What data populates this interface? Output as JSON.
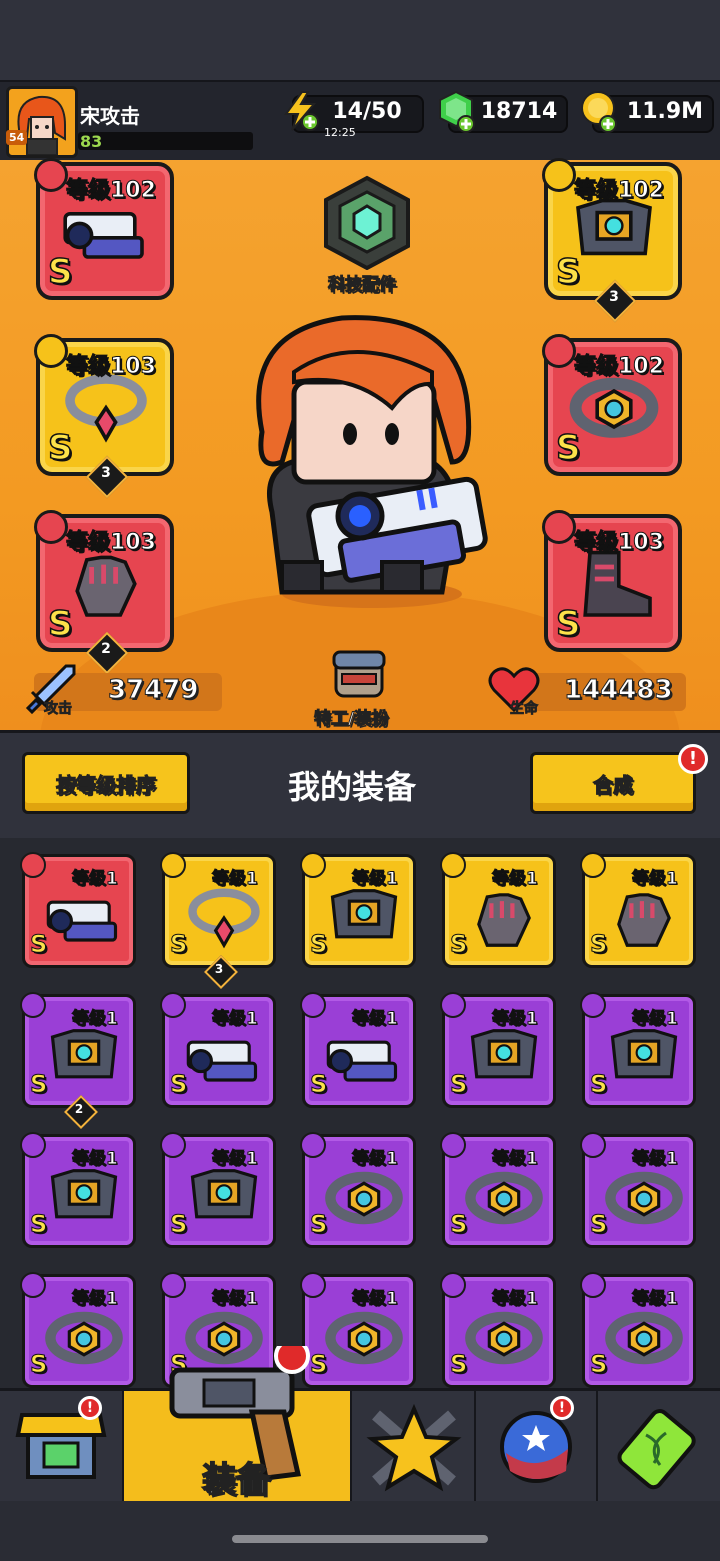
{
  "header": {
    "player_name": "宋攻击",
    "player_level": "83",
    "avatar_level": "54",
    "energy": "14/50",
    "energy_timer": "12:25",
    "gems": "18714",
    "coins": "11.9M"
  },
  "hero": {
    "tech_label": "科技配件",
    "attack_label": "攻击",
    "attack_value": "37479",
    "hp_label": "生命",
    "hp_value": "144483",
    "agent_label": "特工/装扮",
    "slots": [
      {
        "level": "等级102",
        "grade": "S",
        "color": "red",
        "icon": "weapon-icon"
      },
      {
        "level": "等级102",
        "grade": "S",
        "color": "yellow",
        "icon": "armor-icon",
        "count": "3"
      },
      {
        "level": "等级103",
        "grade": "S",
        "color": "yellow",
        "icon": "necklace-icon",
        "count": "3"
      },
      {
        "level": "等级102",
        "grade": "S",
        "color": "red",
        "icon": "belt-icon"
      },
      {
        "level": "等级103",
        "grade": "S",
        "color": "red",
        "icon": "glove-icon",
        "count": "2"
      },
      {
        "level": "等级103",
        "grade": "S",
        "color": "red",
        "icon": "boot-icon"
      }
    ]
  },
  "gear_bar": {
    "sort_button": "按等级排序",
    "title": "我的装备",
    "merge_button": "合成",
    "merge_alert": "!"
  },
  "inventory": [
    {
      "level": "等级1",
      "grade": "S",
      "color": "red",
      "icon": "weapon-icon"
    },
    {
      "level": "等级1",
      "grade": "S",
      "color": "yellow",
      "icon": "necklace-icon",
      "count": "3"
    },
    {
      "level": "等级1",
      "grade": "S",
      "color": "yellow",
      "icon": "armor-icon"
    },
    {
      "level": "等级1",
      "grade": "S",
      "color": "yellow",
      "icon": "glove-icon"
    },
    {
      "level": "等级1",
      "grade": "S",
      "color": "yellow",
      "icon": "glove-icon"
    },
    {
      "level": "等级1",
      "grade": "S",
      "color": "purple",
      "icon": "armor-icon",
      "count": "2"
    },
    {
      "level": "等级1",
      "grade": "S",
      "color": "purple",
      "icon": "weapon-icon"
    },
    {
      "level": "等级1",
      "grade": "S",
      "color": "purple",
      "icon": "weapon-icon"
    },
    {
      "level": "等级1",
      "grade": "S",
      "color": "purple",
      "icon": "armor-icon"
    },
    {
      "level": "等级1",
      "grade": "S",
      "color": "purple",
      "icon": "armor-icon"
    },
    {
      "level": "等级1",
      "grade": "S",
      "color": "purple",
      "icon": "armor-icon"
    },
    {
      "level": "等级1",
      "grade": "S",
      "color": "purple",
      "icon": "armor-icon"
    },
    {
      "level": "等级1",
      "grade": "S",
      "color": "purple",
      "icon": "belt-icon"
    },
    {
      "level": "等级1",
      "grade": "S",
      "color": "purple",
      "icon": "belt-icon"
    },
    {
      "level": "等级1",
      "grade": "S",
      "color": "purple",
      "icon": "belt-icon"
    },
    {
      "level": "等级1",
      "grade": "S",
      "color": "purple",
      "icon": "belt-icon"
    },
    {
      "level": "等级1",
      "grade": "S",
      "color": "purple",
      "icon": "belt-icon"
    },
    {
      "level": "等级1",
      "grade": "S",
      "color": "purple",
      "icon": "belt-icon"
    },
    {
      "level": "等级1",
      "grade": "S",
      "color": "purple",
      "icon": "belt-icon"
    },
    {
      "level": "等级1",
      "grade": "S",
      "color": "purple",
      "icon": "belt-icon"
    }
  ],
  "nav": {
    "active_label": "装备",
    "tabs": [
      "shop-icon",
      "equipment-icon",
      "heroes-icon",
      "planet-icon",
      "gene-icon"
    ]
  },
  "colors": {
    "red": "#e64550",
    "yellow": "#f6c21a",
    "purple": "#9a3fd6",
    "hero_bg": "#f5a330",
    "accent": "#f4bd1c"
  }
}
